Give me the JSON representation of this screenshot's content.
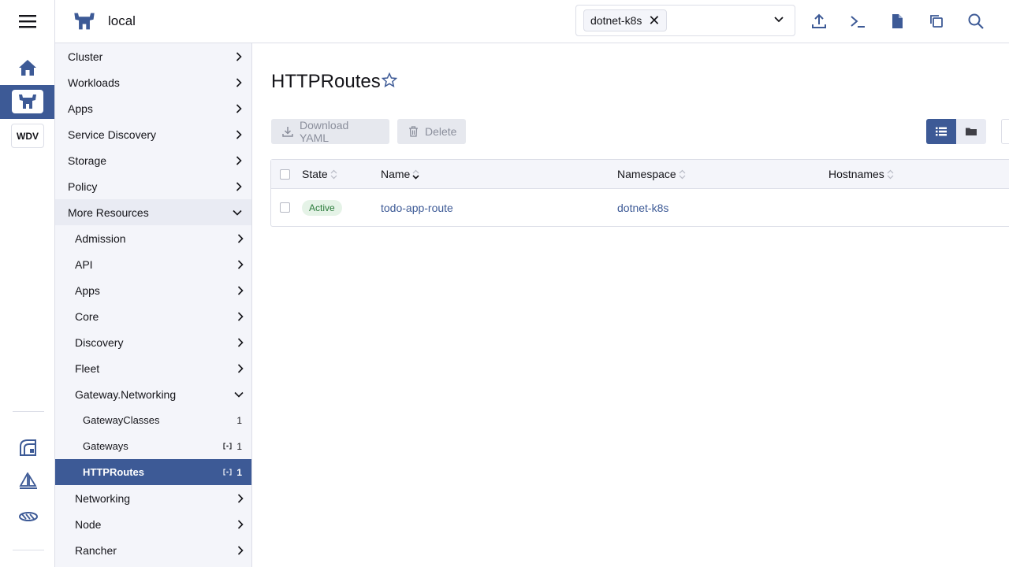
{
  "header": {
    "cluster_name": "local",
    "namespace_chip": "dotnet-k8s",
    "namespace_remove": "✕"
  },
  "rail": {
    "cluster_badge": "WDV"
  },
  "nav": {
    "top_items": [
      {
        "label": "Cluster"
      },
      {
        "label": "Workloads"
      },
      {
        "label": "Apps"
      },
      {
        "label": "Service Discovery"
      },
      {
        "label": "Storage"
      },
      {
        "label": "Policy"
      }
    ],
    "more_resources": "More Resources",
    "groups": [
      {
        "label": "Admission"
      },
      {
        "label": "API"
      },
      {
        "label": "Apps"
      },
      {
        "label": "Core"
      },
      {
        "label": "Discovery"
      },
      {
        "label": "Fleet"
      }
    ],
    "gateway_group": "Gateway.Networking",
    "gateway_items": [
      {
        "label": "GatewayClasses",
        "count": "1",
        "namespaced": false
      },
      {
        "label": "Gateways",
        "count": "1",
        "namespaced": true
      },
      {
        "label": "HTTPRoutes",
        "count": "1",
        "namespaced": true,
        "selected": true
      }
    ],
    "after_groups": [
      {
        "label": "Networking"
      },
      {
        "label": "Node"
      },
      {
        "label": "Rancher"
      }
    ]
  },
  "main": {
    "title": "HTTPRoutes",
    "download_label": "Download YAML",
    "delete_label": "Delete",
    "table": {
      "columns": [
        "State",
        "Name",
        "Namespace",
        "Hostnames"
      ],
      "rows": [
        {
          "state": "Active",
          "name": "todo-app-route",
          "namespace": "dotnet-k8s",
          "hostnames": ""
        }
      ]
    }
  },
  "colors": {
    "accent": "#3d5a96",
    "active_badge": "#e5f3e7",
    "active_text": "#2a7a3a"
  }
}
